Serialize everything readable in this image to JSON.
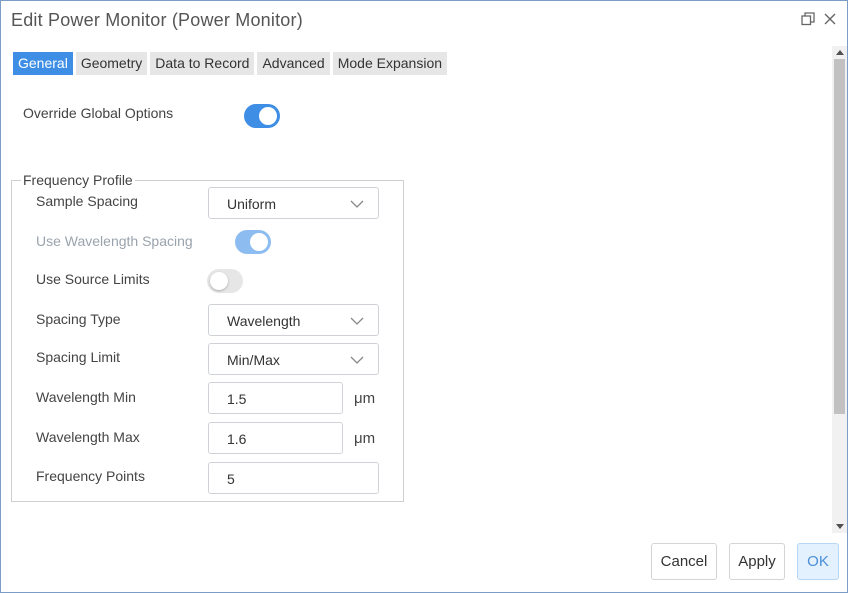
{
  "window": {
    "title": "Edit Power Monitor (Power Monitor)",
    "restore_icon": "restore-icon",
    "close_icon": "close-icon"
  },
  "tabs": [
    {
      "label": "General",
      "active": true
    },
    {
      "label": "Geometry",
      "active": false
    },
    {
      "label": "Data to Record",
      "active": false
    },
    {
      "label": "Advanced",
      "active": false
    },
    {
      "label": "Mode Expansion",
      "active": false
    }
  ],
  "general": {
    "override_label": "Override Global Options",
    "override_on": true
  },
  "frequency_profile": {
    "title": "Frequency Profile",
    "sample_spacing": {
      "label": "Sample Spacing",
      "value": "Uniform"
    },
    "use_wavelength_spacing": {
      "label": "Use Wavelength Spacing",
      "on": true,
      "disabled": true
    },
    "use_source_limits": {
      "label": "Use Source Limits",
      "on": false
    },
    "spacing_type": {
      "label": "Spacing Type",
      "value": "Wavelength"
    },
    "spacing_limit": {
      "label": "Spacing Limit",
      "value": "Min/Max"
    },
    "wavelength_min": {
      "label": "Wavelength Min",
      "value": "1.5",
      "unit": "μm"
    },
    "wavelength_max": {
      "label": "Wavelength Max",
      "value": "1.6",
      "unit": "μm"
    },
    "frequency_points": {
      "label": "Frequency Points",
      "value": "5"
    }
  },
  "buttons": {
    "cancel": "Cancel",
    "apply": "Apply",
    "ok": "OK"
  },
  "colors": {
    "accent": "#3d8ee4",
    "accent_disabled": "#8dbdf0",
    "ok_background": "#e3f0fd"
  }
}
